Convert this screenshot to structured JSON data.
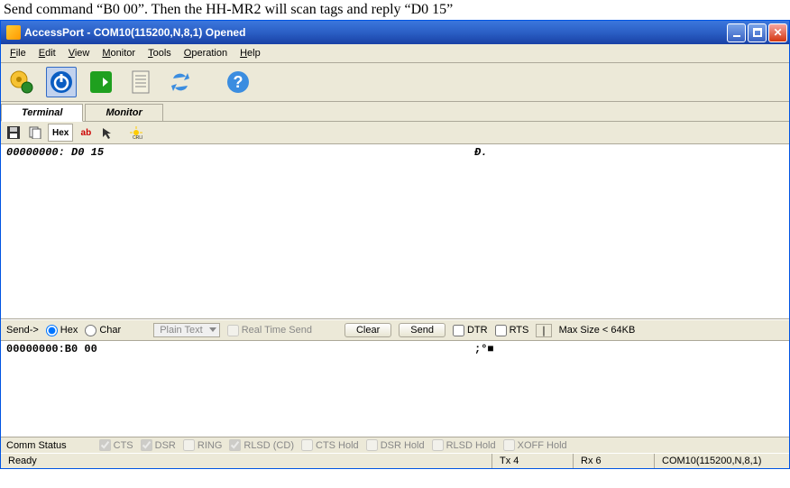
{
  "caption": "Send command “B0 00”. Then the HH-MR2 will scan tags and reply “D0 15”",
  "window": {
    "title": "AccessPort - COM10(115200,N,8,1) Opened"
  },
  "menu": {
    "file": "File",
    "edit": "Edit",
    "view": "View",
    "monitor": "Monitor",
    "tools": "Tools",
    "operation": "Operation",
    "help": "Help"
  },
  "tabs": {
    "terminal": "Terminal",
    "monitor": "Monitor"
  },
  "rxbar": {
    "hex": "Hex",
    "ab": "ab"
  },
  "terminal": {
    "line": "00000000: D0 15",
    "ascii": "Ð."
  },
  "sendbar": {
    "label": "Send->",
    "hex": "Hex",
    "char": "Char",
    "plaintext": "Plain Text",
    "realtime": "Real Time Send",
    "clear": "Clear",
    "send": "Send",
    "dtr": "DTR",
    "rts": "RTS",
    "maxsize": "Max Size < 64KB"
  },
  "sendarea": {
    "line": "00000000:B0 00",
    "ascii": ";°■"
  },
  "comm": {
    "label": "Comm Status",
    "cts": "CTS",
    "dsr": "DSR",
    "ring": "RING",
    "rlsdcd": "RLSD (CD)",
    "ctshold": "CTS Hold",
    "dsrhold": "DSR Hold",
    "rlsdhold": "RLSD Hold",
    "xoffhold": "XOFF Hold"
  },
  "status": {
    "ready": "Ready",
    "tx": "Tx 4",
    "rx": "Rx 6",
    "port": "COM10(115200,N,8,1)"
  }
}
